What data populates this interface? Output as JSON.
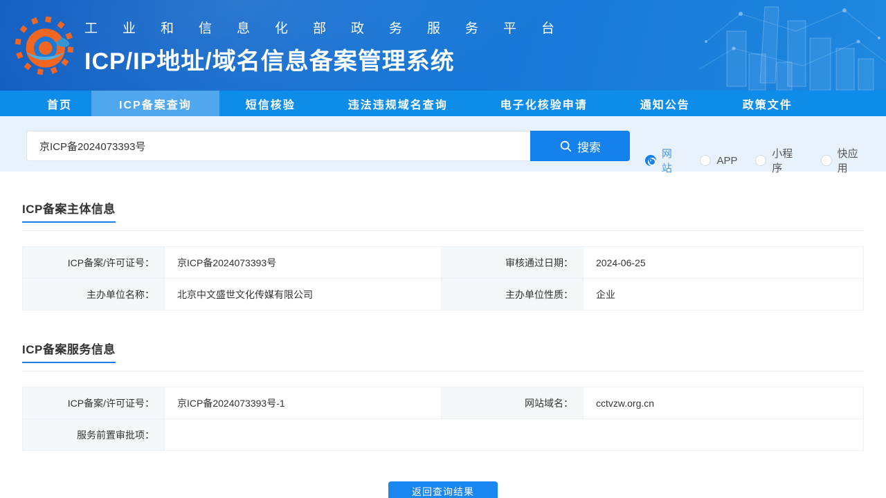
{
  "header": {
    "platform_line": "工业和信息化部政务服务平台",
    "system_title": "ICP/IP地址/域名信息备案管理系统"
  },
  "nav": {
    "items": [
      {
        "label": "首页",
        "active": false
      },
      {
        "label": "ICP备案查询",
        "active": true
      },
      {
        "label": "短信核验",
        "active": false
      },
      {
        "label": "违法违规域名查询",
        "active": false
      },
      {
        "label": "电子化核验申请",
        "active": false
      },
      {
        "label": "通知公告",
        "active": false
      },
      {
        "label": "政策文件",
        "active": false
      }
    ]
  },
  "search": {
    "input_value": "京ICP备2024073393号",
    "button_label": "搜索",
    "radios": [
      {
        "label": "网站",
        "selected": true
      },
      {
        "label": "APP",
        "selected": false
      },
      {
        "label": "小程序",
        "selected": false
      },
      {
        "label": "快应用",
        "selected": false
      }
    ]
  },
  "subject_section": {
    "title": "ICP备案主体信息",
    "r0": {
      "l0": "ICP备案/许可证号：",
      "v0": "京ICP备2024073393号",
      "l1": "审核通过日期：",
      "v1": "2024-06-25"
    },
    "r1": {
      "l0": "主办单位名称：",
      "v0": "北京中文盛世文化传媒有限公司",
      "l1": "主办单位性质：",
      "v1": "企业"
    }
  },
  "service_section": {
    "title": "ICP备案服务信息",
    "r0": {
      "l0": "ICP备案/许可证号：",
      "v0": "京ICP备2024073393号-1",
      "l1": "网站域名：",
      "v1": "cctvzw.org.cn"
    },
    "r1": {
      "l0": "服务前置审批项：",
      "v0": ""
    }
  },
  "footer": {
    "back_button_label": "返回查询结果"
  },
  "colors": {
    "header_blue_dark": "#0f5bbf",
    "header_blue_light": "#1e88e0",
    "nav_blue": "#0e8ce9",
    "nav_active_blue": "#50a7ed",
    "search_strip_bg": "#e7f2fc",
    "accent_blue": "#1581ec",
    "label_cell_bg": "#f4f8fb",
    "logo_orange": "#f2601a"
  }
}
